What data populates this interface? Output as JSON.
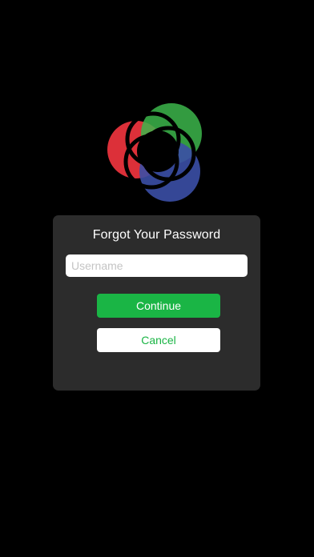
{
  "logo": {
    "icon": "overlapping-rgb-circles-logo",
    "colors": {
      "red": "#e8333c",
      "green": "#3cb64b",
      "blue": "#3b4fa6",
      "outline": "#000000"
    }
  },
  "dialog": {
    "title": "Forgot Your Password",
    "username_placeholder": "Username",
    "username_value": "",
    "continue_label": "Continue",
    "cancel_label": "Cancel"
  },
  "colors": {
    "background": "#000000",
    "card": "#2c2c2c",
    "accent": "#1ab545"
  }
}
